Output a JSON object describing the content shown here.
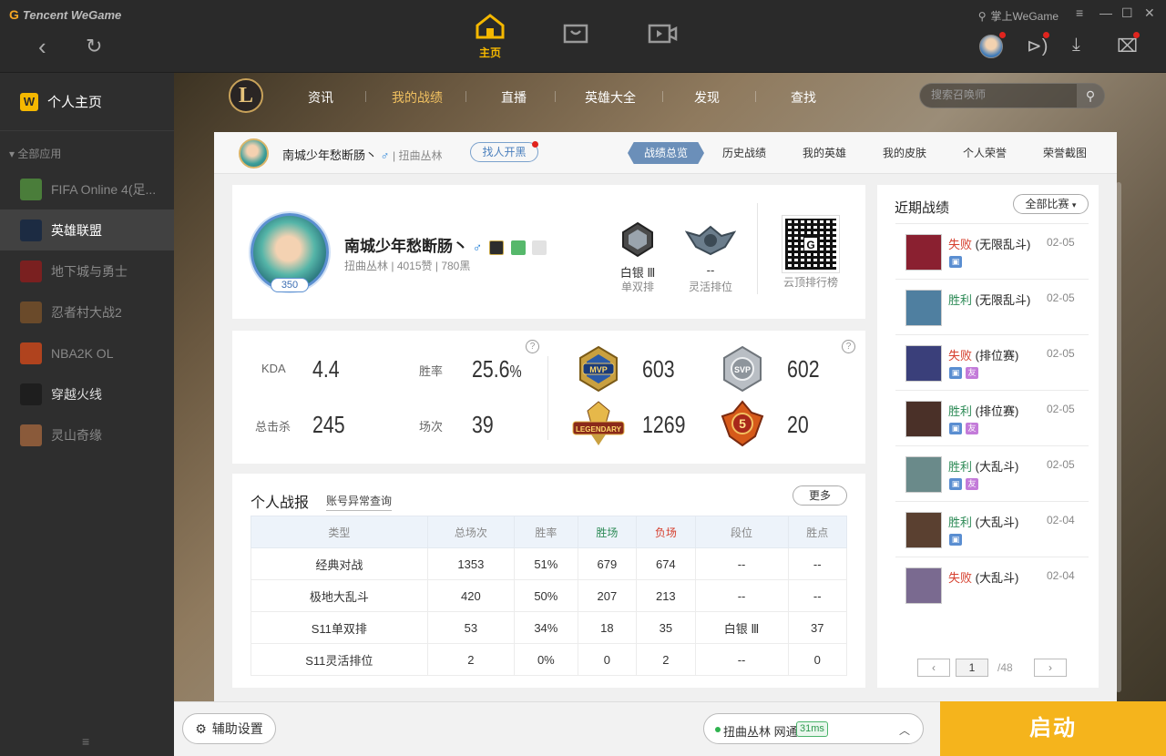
{
  "app": {
    "brand": "Tencent WeGame"
  },
  "top_nav": {
    "home_label": "主页",
    "palm_link": "掌上WeGame"
  },
  "sidebar": {
    "home": "个人主页",
    "section": "全部应用",
    "games": [
      {
        "label": "FIFA Online 4(足...",
        "color": "#4a7d3a"
      },
      {
        "label": "英雄联盟",
        "color": "#1c2b42"
      },
      {
        "label": "地下城与勇士",
        "color": "#7a2020"
      },
      {
        "label": "忍者村大战2",
        "color": "#6a4a2a"
      },
      {
        "label": "NBA2K OL",
        "color": "#b0431e"
      },
      {
        "label": "穿越火线",
        "color": "#1e1e1e"
      },
      {
        "label": "灵山奇缘",
        "color": "#8a5a3a"
      }
    ]
  },
  "lol_nav": {
    "items": [
      "资讯",
      "我的战绩",
      "直播",
      "英雄大全",
      "发现",
      "查找"
    ],
    "search_placeholder": "搜索召唤师"
  },
  "player_bar": {
    "name": "南城少年愁断肠丶",
    "gender": "♂",
    "server": "扭曲丛林",
    "find_btn": "找人开黑",
    "tabs": [
      "战绩总览",
      "历史战绩",
      "我的英雄",
      "我的皮肤",
      "个人荣誉",
      "荣誉截图"
    ]
  },
  "profile": {
    "name": "南城少年愁断肠丶",
    "gender": "♂",
    "server": "扭曲丛林",
    "likes": "4015赞",
    "blacks": "780黑",
    "level": "350",
    "ranks": [
      {
        "tier": "白银 Ⅲ",
        "queue": "单双排"
      },
      {
        "tier": "--",
        "queue": "灵活排位"
      }
    ],
    "qr_label": "云顶排行榜"
  },
  "summary": {
    "kda_label": "KDA",
    "kda": "4.4",
    "winrate_label": "胜率",
    "winrate": "25.6",
    "winrate_unit": "%",
    "kills_label": "总击杀",
    "kills": "245",
    "games_label": "场次",
    "games": "39",
    "emblems": [
      {
        "name": "MVP",
        "value": "603"
      },
      {
        "name": "SVP",
        "value": "602"
      },
      {
        "name": "LEGENDARY",
        "value": "1269"
      },
      {
        "name": "5",
        "value": "20"
      }
    ],
    "help": "?"
  },
  "report": {
    "title": "个人战报",
    "link": "账号异常查询",
    "more": "更多",
    "headers": [
      "类型",
      "总场次",
      "胜率",
      "胜场",
      "负场",
      "段位",
      "胜点"
    ],
    "rows": [
      [
        "经典对战",
        "1353",
        "51%",
        "679",
        "674",
        "--",
        "--"
      ],
      [
        "极地大乱斗",
        "420",
        "50%",
        "207",
        "213",
        "--",
        "--"
      ],
      [
        "S11单双排",
        "53",
        "34%",
        "18",
        "35",
        "白银 Ⅲ",
        "37"
      ],
      [
        "S11灵活排位",
        "2",
        "0%",
        "0",
        "2",
        "--",
        "0"
      ]
    ]
  },
  "recent": {
    "title": "近期战绩",
    "filter": "全部比赛",
    "matches": [
      {
        "result": "失败",
        "win": false,
        "mode": "(无限乱斗)",
        "date": "02-05",
        "img": true,
        "friend": false,
        "color": "#8a2030"
      },
      {
        "result": "胜利",
        "win": true,
        "mode": "(无限乱斗)",
        "date": "02-05",
        "img": false,
        "friend": false,
        "color": "#4f7fa0"
      },
      {
        "result": "失败",
        "win": false,
        "mode": "(排位赛)",
        "date": "02-05",
        "img": true,
        "friend": true,
        "color": "#3a3f7a"
      },
      {
        "result": "胜利",
        "win": true,
        "mode": "(排位赛)",
        "date": "02-05",
        "img": true,
        "friend": true,
        "color": "#4a3028"
      },
      {
        "result": "胜利",
        "win": true,
        "mode": "(大乱斗)",
        "date": "02-05",
        "img": true,
        "friend": true,
        "color": "#6a8a8a"
      },
      {
        "result": "胜利",
        "win": true,
        "mode": "(大乱斗)",
        "date": "02-04",
        "img": true,
        "friend": false,
        "color": "#5a4030"
      },
      {
        "result": "失败",
        "win": false,
        "mode": "(大乱斗)",
        "date": "02-04",
        "img": false,
        "friend": false,
        "color": "#7a6a90"
      }
    ],
    "page": "1",
    "total": "/48"
  },
  "bottom": {
    "assist": "辅助设置",
    "server": "扭曲丛林 网通",
    "ping": "31ms",
    "launch": "启动"
  }
}
